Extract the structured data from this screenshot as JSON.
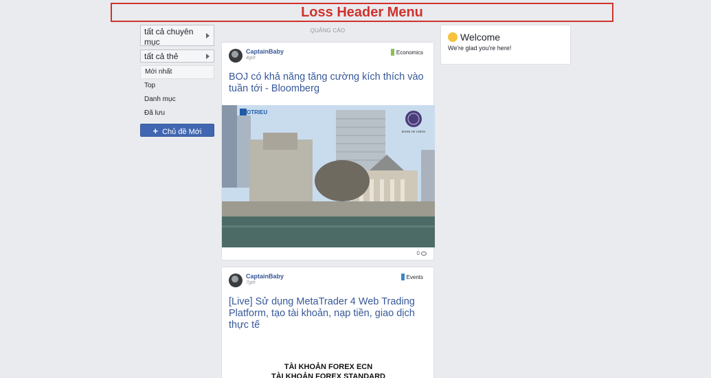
{
  "header": {
    "title": "Loss Header Menu"
  },
  "sidebar": {
    "categories_label": "tất cả chuyên mục",
    "tags_label": "tất cả thẻ",
    "nav": [
      {
        "label": "Mới nhất"
      },
      {
        "label": "Top"
      },
      {
        "label": "Danh mục"
      },
      {
        "label": "Đã lưu"
      }
    ],
    "new_topic_label": "Chủ đề Mới"
  },
  "feed": {
    "ad_label": "QUẢNG CÁO",
    "posts": [
      {
        "author": "CaptainBaby",
        "time": "4giờ",
        "category": "Economics",
        "category_color": "#8cc152",
        "title": "BOJ có khả năng tăng cường kích thích vào tuần tới - Bloomberg",
        "image_brand": "TOTRIEU",
        "image_seal_text": "BANK OF JAPAN",
        "comments": "0"
      },
      {
        "author": "CaptainBaby",
        "time": "7giờ",
        "category": "Events",
        "category_color": "#3a87c8",
        "title": "[Live] Sử dụng MetaTrader 4 Web Trading Platform, tạo tài khoản, nạp tiền, giao dịch thực tế",
        "promo_line1": "TÀI KHOẢN FOREX ECN",
        "promo_line2": "TÀI KHOẢN FOREX STANDARD"
      }
    ]
  },
  "widget": {
    "title": "Welcome",
    "text": "We're glad you're here!"
  }
}
